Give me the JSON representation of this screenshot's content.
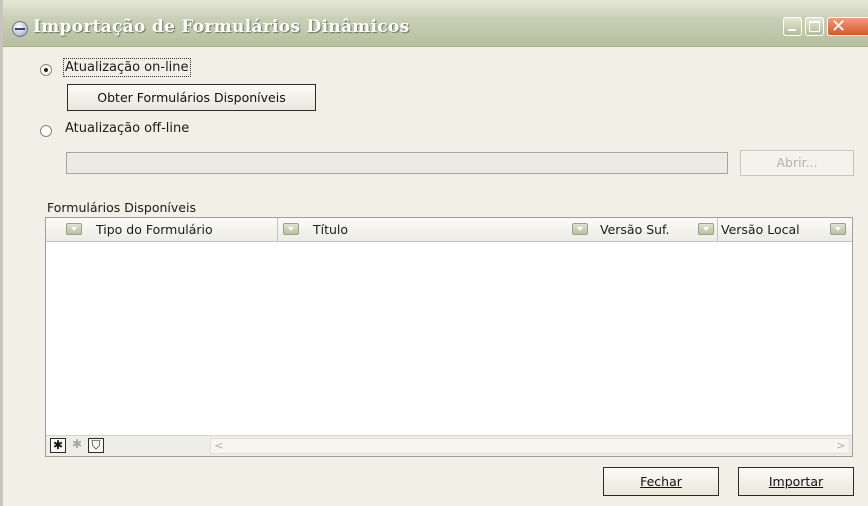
{
  "window": {
    "title": "Importação de Formulários Dinâmicos",
    "close_glyph": "✕"
  },
  "online": {
    "radio_label": "Atualização on-line",
    "selected": true,
    "obter_button_label": "Obter Formulários Disponíveis"
  },
  "offline": {
    "radio_label": "Atualização off-line",
    "selected": false,
    "path_value": "",
    "abrir_button_label": "Abrir..."
  },
  "grid": {
    "title": "Formulários Disponíveis",
    "columns": [
      "Tipo do Formulário",
      "Título",
      "Versão Suf.",
      "Versão Local"
    ],
    "rows": [],
    "toolbar": {
      "add_glyph": "✱",
      "add_disabled_glyph": "✱",
      "filter_glyph": "⛉"
    },
    "scroll": {
      "left_glyph": "<",
      "right_glyph": ">"
    }
  },
  "footer": {
    "fechar_label": "Fechar",
    "importar_label": "Importar"
  }
}
